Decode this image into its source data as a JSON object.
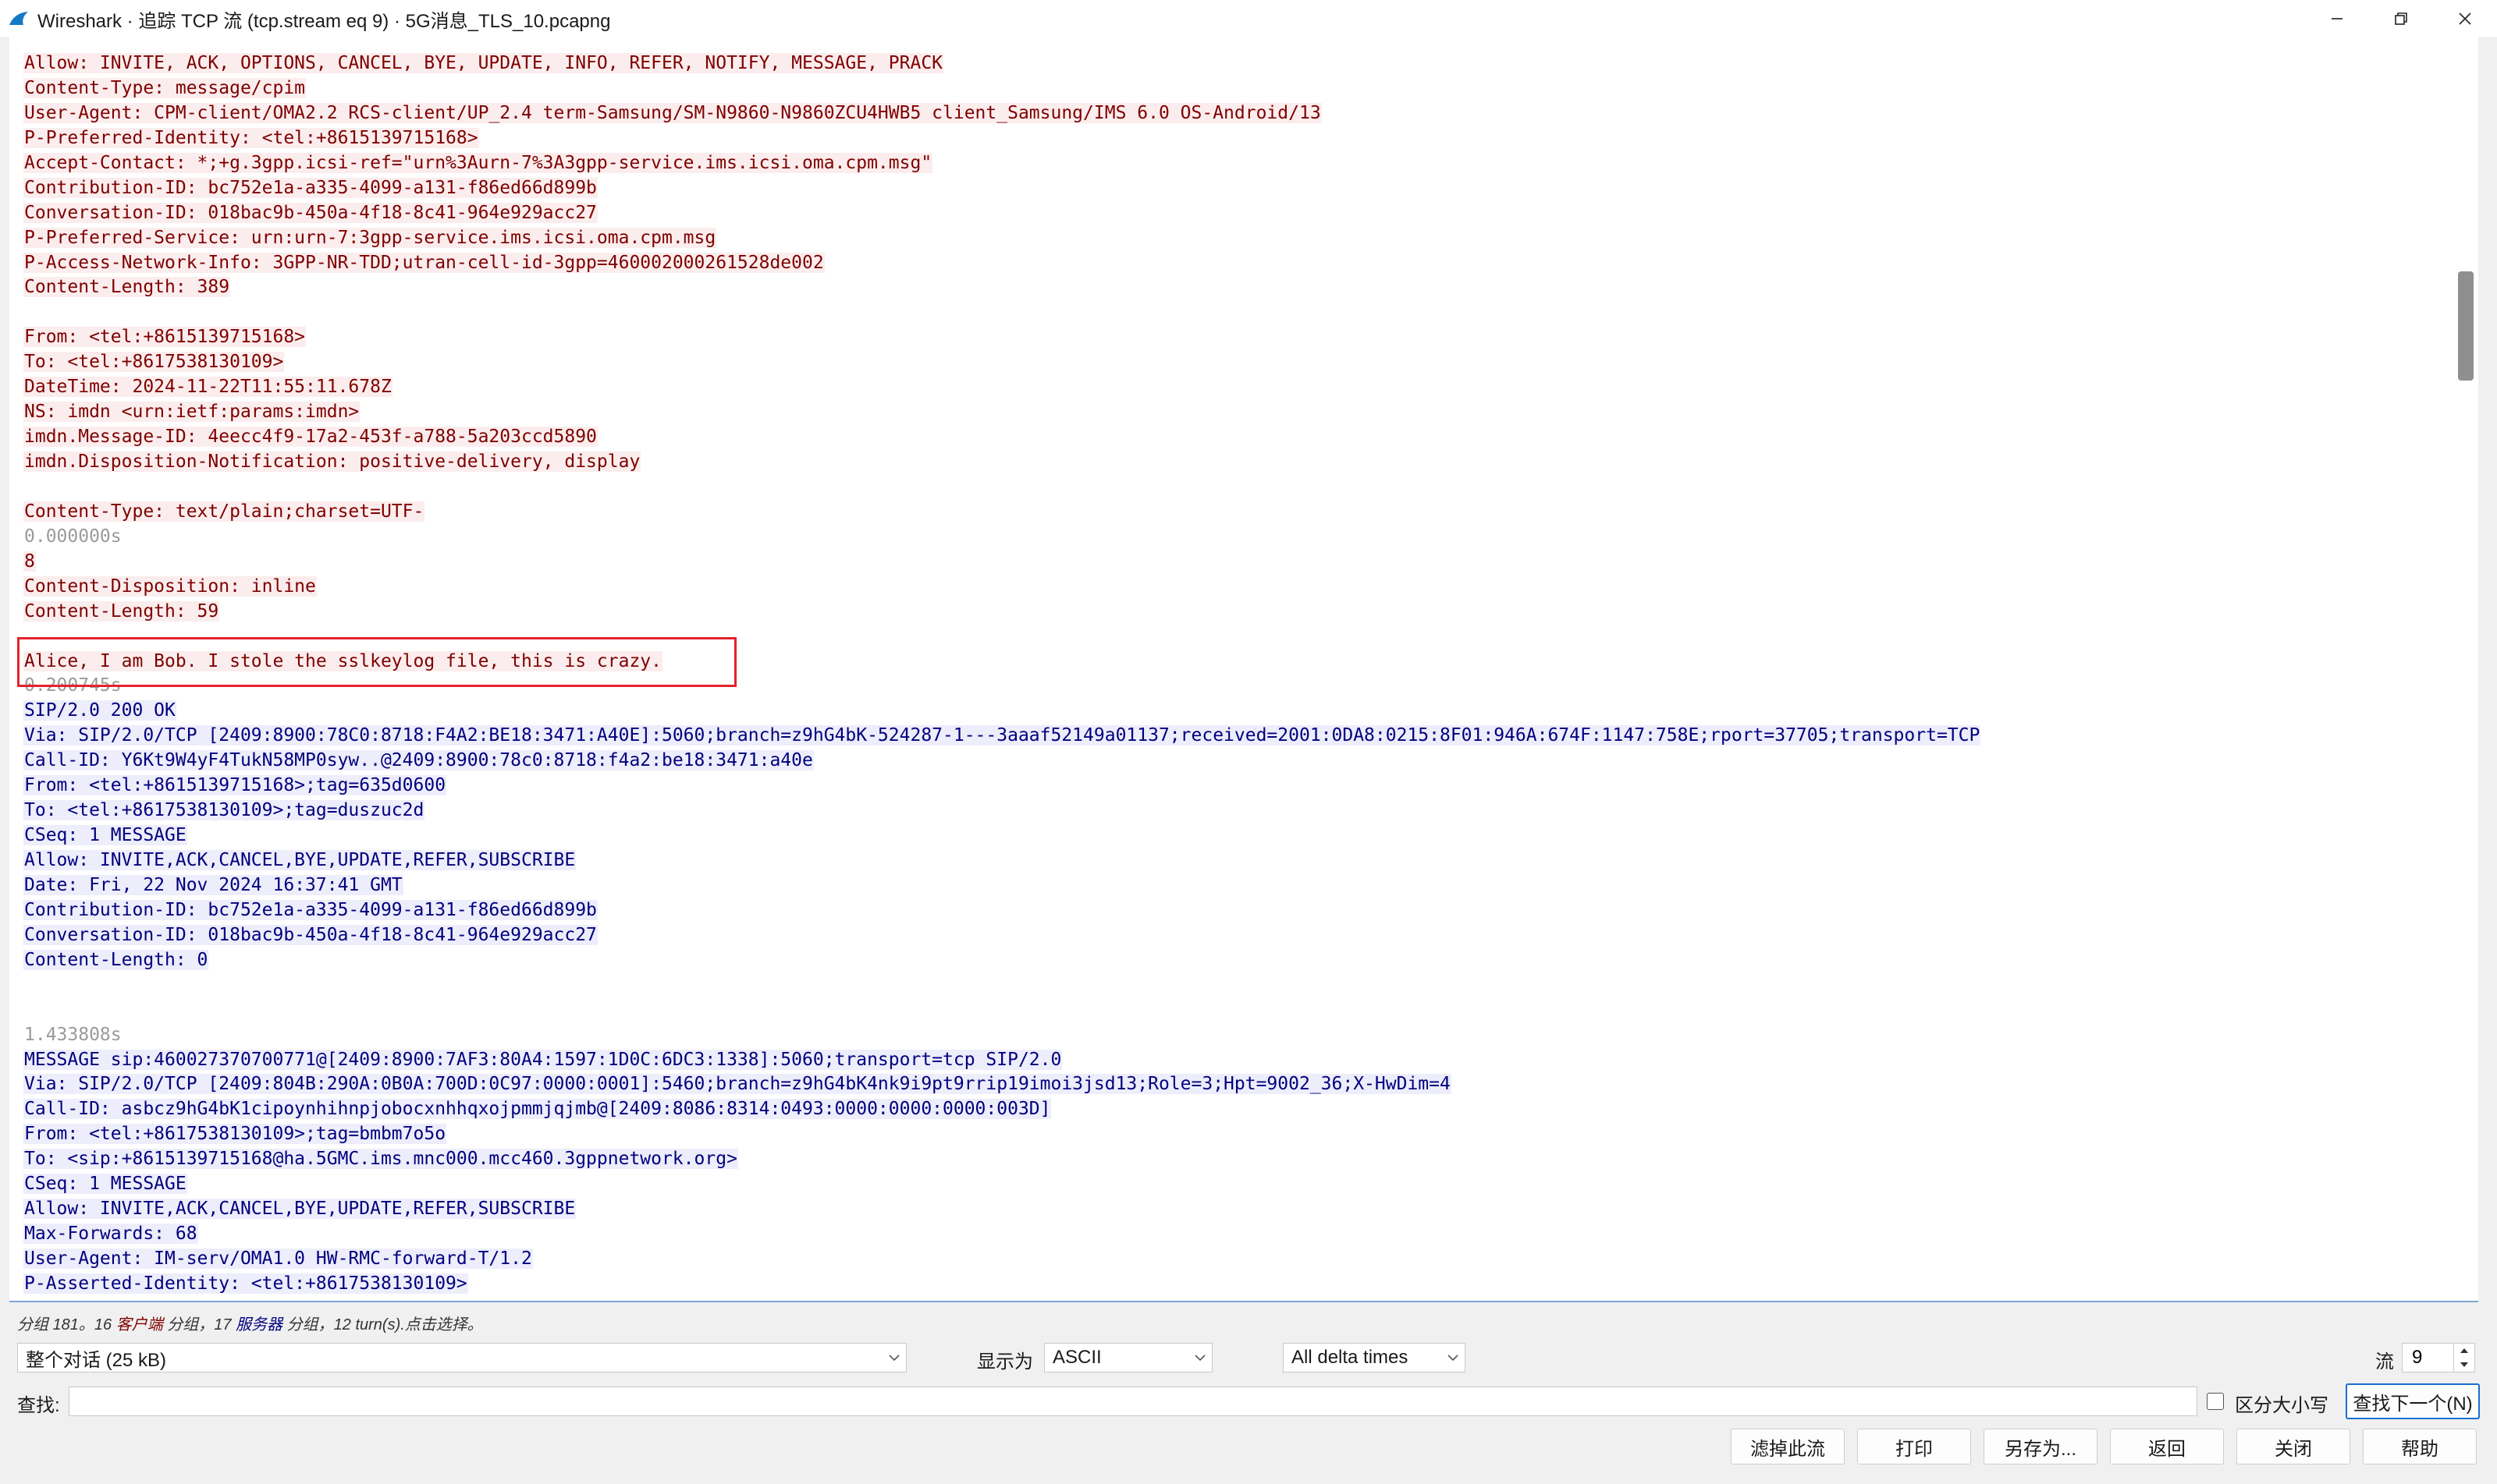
{
  "window": {
    "title": "Wireshark · 追踪 TCP 流 (tcp.stream eq 9) · 5G消息_TLS_10.pcapng"
  },
  "stream_lines": [
    {
      "t": "client",
      "text": "Allow: INVITE, ACK, OPTIONS, CANCEL, BYE, UPDATE, INFO, REFER, NOTIFY, MESSAGE, PRACK"
    },
    {
      "t": "client",
      "text": "Content-Type: message/cpim"
    },
    {
      "t": "client",
      "text": "User-Agent: CPM-client/OMA2.2 RCS-client/UP_2.4 term-Samsung/SM-N9860-N9860ZCU4HWB5 client_Samsung/IMS 6.0 OS-Android/13"
    },
    {
      "t": "client",
      "text": "P-Preferred-Identity: <tel:+8615139715168>"
    },
    {
      "t": "client",
      "text": "Accept-Contact: *;+g.3gpp.icsi-ref=\"urn%3Aurn-7%3A3gpp-service.ims.icsi.oma.cpm.msg\""
    },
    {
      "t": "client",
      "text": "Contribution-ID: bc752e1a-a335-4099-a131-f86ed66d899b"
    },
    {
      "t": "client",
      "text": "Conversation-ID: 018bac9b-450a-4f18-8c41-964e929acc27"
    },
    {
      "t": "client",
      "text": "P-Preferred-Service: urn:urn-7:3gpp-service.ims.icsi.oma.cpm.msg"
    },
    {
      "t": "client",
      "text": "P-Access-Network-Info: 3GPP-NR-TDD;utran-cell-id-3gpp=460002000261528de002"
    },
    {
      "t": "client",
      "text": "Content-Length: 389"
    },
    {
      "t": "empty",
      "text": ""
    },
    {
      "t": "client",
      "text": "From: <tel:+8615139715168>"
    },
    {
      "t": "client",
      "text": "To: <tel:+8617538130109>"
    },
    {
      "t": "client",
      "text": "DateTime: 2024-11-22T11:55:11.678Z"
    },
    {
      "t": "client",
      "text": "NS: imdn <urn:ietf:params:imdn>"
    },
    {
      "t": "client",
      "text": "imdn.Message-ID: 4eecc4f9-17a2-453f-a788-5a203ccd5890"
    },
    {
      "t": "client",
      "text": "imdn.Disposition-Notification: positive-delivery, display"
    },
    {
      "t": "empty",
      "text": ""
    },
    {
      "t": "client",
      "text": "Content-Type: text/plain;charset=UTF-"
    },
    {
      "t": "ts",
      "text": "0.000000s"
    },
    {
      "t": "client",
      "text": "8"
    },
    {
      "t": "client",
      "text": "Content-Disposition: inline"
    },
    {
      "t": "client",
      "text": "Content-Length: 59"
    },
    {
      "t": "empty",
      "text": ""
    },
    {
      "t": "client",
      "text": "Alice, I am Bob. I stole the sslkeylog file, this is crazy."
    },
    {
      "t": "ts",
      "text": "0.200745s"
    },
    {
      "t": "server",
      "text": "SIP/2.0 200 OK"
    },
    {
      "t": "server",
      "text": "Via: SIP/2.0/TCP [2409:8900:78C0:8718:F4A2:BE18:3471:A40E]:5060;branch=z9hG4bK-524287-1---3aaaf52149a01137;received=2001:0DA8:0215:8F01:946A:674F:1147:758E;rport=37705;transport=TCP"
    },
    {
      "t": "server",
      "text": "Call-ID: Y6Kt9W4yF4TukN58MP0syw..@2409:8900:78c0:8718:f4a2:be18:3471:a40e"
    },
    {
      "t": "server",
      "text": "From: <tel:+8615139715168>;tag=635d0600"
    },
    {
      "t": "server",
      "text": "To: <tel:+8617538130109>;tag=duszuc2d"
    },
    {
      "t": "server",
      "text": "CSeq: 1 MESSAGE"
    },
    {
      "t": "server",
      "text": "Allow: INVITE,ACK,CANCEL,BYE,UPDATE,REFER,SUBSCRIBE"
    },
    {
      "t": "server",
      "text": "Date: Fri, 22 Nov 2024 16:37:41 GMT"
    },
    {
      "t": "server",
      "text": "Contribution-ID: bc752e1a-a335-4099-a131-f86ed66d899b"
    },
    {
      "t": "server",
      "text": "Conversation-ID: 018bac9b-450a-4f18-8c41-964e929acc27"
    },
    {
      "t": "server",
      "text": "Content-Length: 0"
    },
    {
      "t": "empty",
      "text": ""
    },
    {
      "t": "empty",
      "text": ""
    },
    {
      "t": "ts",
      "text": "1.433808s"
    },
    {
      "t": "server",
      "text": "MESSAGE sip:460027370700771@[2409:8900:7AF3:80A4:1597:1D0C:6DC3:1338]:5060;transport=tcp SIP/2.0"
    },
    {
      "t": "server",
      "text": "Via: SIP/2.0/TCP [2409:804B:290A:0B0A:700D:0C97:0000:0001]:5460;branch=z9hG4bK4nk9i9pt9rrip19imoi3jsd13;Role=3;Hpt=9002_36;X-HwDim=4"
    },
    {
      "t": "server",
      "text": "Call-ID: asbcz9hG4bK1cipoynhihnpjobocxnhhqxojpmmjqjmb@[2409:8086:8314:0493:0000:0000:0000:003D]"
    },
    {
      "t": "server",
      "text": "From: <tel:+8617538130109>;tag=bmbm7o5o"
    },
    {
      "t": "server",
      "text": "To: <sip:+8615139715168@ha.5GMC.ims.mnc000.mcc460.3gppnetwork.org>"
    },
    {
      "t": "server",
      "text": "CSeq: 1 MESSAGE"
    },
    {
      "t": "server",
      "text": "Allow: INVITE,ACK,CANCEL,BYE,UPDATE,REFER,SUBSCRIBE"
    },
    {
      "t": "server",
      "text": "Max-Forwards: 68"
    },
    {
      "t": "server",
      "text": "User-Agent: IM-serv/OMA1.0 HW-RMC-forward-T/1.2"
    },
    {
      "t": "server",
      "text": "P-Asserted-Identity: <tel:+8617538130109>"
    }
  ],
  "status": {
    "prefix": "分组 181。16 ",
    "client_word": "客户端",
    "middle": " 分组，17 ",
    "server_word": "服务器",
    "suffix": " 分组，12 turn(s).点击选择。"
  },
  "controls": {
    "conversation_select": "整个对话 (25 kB)",
    "show_as_label": "显示为",
    "show_as_value": "ASCII",
    "delta_select": "All delta times",
    "stream_label": "流",
    "stream_value": "9",
    "find_label": "查找:",
    "find_value": "",
    "case_label": "区分大小写",
    "find_next": "查找下一个(N)"
  },
  "buttons": {
    "filter_out": "滤掉此流",
    "print": "打印",
    "save_as": "另存为...",
    "back": "返回",
    "close": "关闭",
    "help": "帮助"
  },
  "colors": {
    "client_text": "#7f0000",
    "server_text": "#00007f",
    "highlight_box": "#e3232c"
  }
}
